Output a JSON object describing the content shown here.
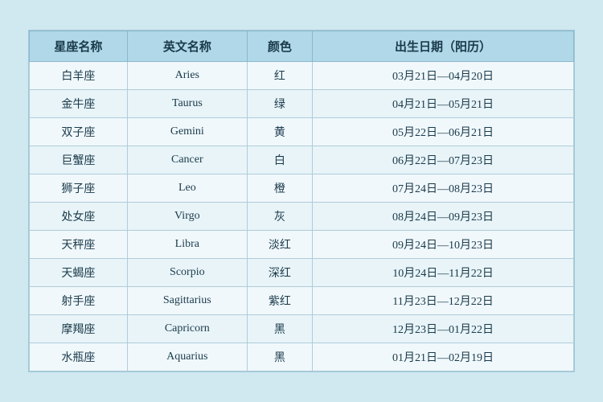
{
  "table": {
    "headers": [
      "星座名称",
      "英文名称",
      "颜色",
      "出生日期（阳历）"
    ],
    "rows": [
      {
        "cn": "白羊座",
        "en": "Aries",
        "color": "红",
        "date": "03月21日—04月20日"
      },
      {
        "cn": "金牛座",
        "en": "Taurus",
        "color": "绿",
        "date": "04月21日—05月21日"
      },
      {
        "cn": "双子座",
        "en": "Gemini",
        "color": "黄",
        "date": "05月22日—06月21日"
      },
      {
        "cn": "巨蟹座",
        "en": "Cancer",
        "color": "白",
        "date": "06月22日—07月23日"
      },
      {
        "cn": "狮子座",
        "en": "Leo",
        "color": "橙",
        "date": "07月24日—08月23日"
      },
      {
        "cn": "处女座",
        "en": "Virgo",
        "color": "灰",
        "date": "08月24日—09月23日"
      },
      {
        "cn": "天秤座",
        "en": "Libra",
        "color": "淡红",
        "date": "09月24日—10月23日"
      },
      {
        "cn": "天蝎座",
        "en": "Scorpio",
        "color": "深红",
        "date": "10月24日—11月22日"
      },
      {
        "cn": "射手座",
        "en": "Sagittarius",
        "color": "紫红",
        "date": "11月23日—12月22日"
      },
      {
        "cn": "摩羯座",
        "en": "Capricorn",
        "color": "黑",
        "date": "12月23日—01月22日"
      },
      {
        "cn": "水瓶座",
        "en": "Aquarius",
        "color": "黑",
        "date": "01月21日—02月19日"
      }
    ]
  }
}
